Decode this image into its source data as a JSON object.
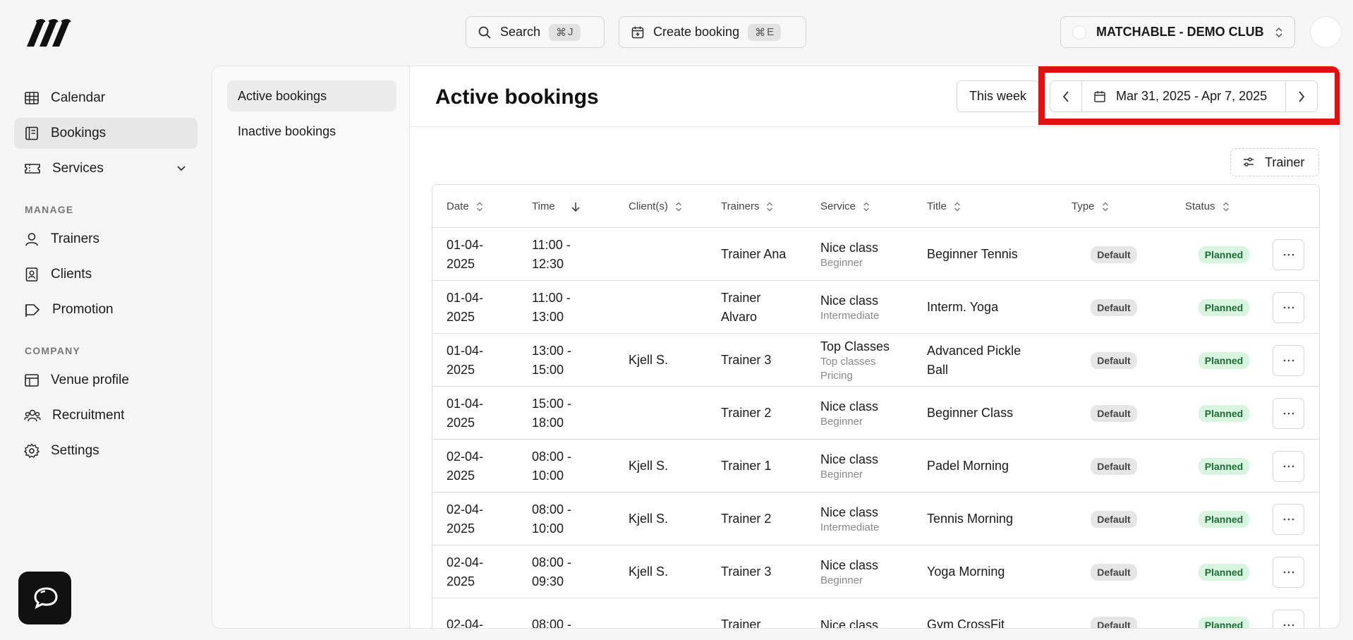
{
  "topbar": {
    "search_label": "Search",
    "search_shortcut_key": "J",
    "create_label": "Create booking",
    "create_shortcut_key": "E",
    "club_name": "MATCHABLE - DEMO CLUB"
  },
  "sidebar": {
    "items": [
      {
        "label": "Calendar",
        "icon": "calendar-grid-icon"
      },
      {
        "label": "Bookings",
        "icon": "bookings-icon"
      },
      {
        "label": "Services",
        "icon": "ticket-icon"
      }
    ],
    "manage_label": "MANAGE",
    "manage_items": [
      {
        "label": "Trainers",
        "icon": "user-icon"
      },
      {
        "label": "Clients",
        "icon": "contact-icon"
      },
      {
        "label": "Promotion",
        "icon": "tag-icon"
      }
    ],
    "company_label": "COMPANY",
    "company_items": [
      {
        "label": "Venue profile",
        "icon": "layout-icon"
      },
      {
        "label": "Recruitment",
        "icon": "users-icon"
      },
      {
        "label": "Settings",
        "icon": "gear-icon"
      }
    ]
  },
  "subnav": {
    "active": "Active bookings",
    "inactive": "Inactive bookings"
  },
  "main": {
    "title": "Active bookings",
    "this_week": "This week",
    "date_range": "Mar 31, 2025 - Apr 7, 2025",
    "filter_label": "Trainer"
  },
  "table": {
    "headers": [
      "Date",
      "Time",
      "Client(s)",
      "Trainers",
      "Service",
      "Title",
      "Type",
      "Status"
    ],
    "rows": [
      {
        "date1": "01-04-",
        "date2": "2025",
        "time1": "11:00 -",
        "time2": "12:30",
        "client": "",
        "trainer1": "Trainer Ana",
        "trainer2": "",
        "service": "Nice class",
        "service_sub": "Beginner",
        "service_sub2": "",
        "title1": "Beginner Tennis",
        "title2": "",
        "type": "Default",
        "status": "Planned"
      },
      {
        "date1": "01-04-",
        "date2": "2025",
        "time1": "11:00 -",
        "time2": "13:00",
        "client": "",
        "trainer1": "Trainer",
        "trainer2": "Alvaro",
        "service": "Nice class",
        "service_sub": "Intermediate",
        "service_sub2": "",
        "title1": "Interm. Yoga",
        "title2": "",
        "type": "Default",
        "status": "Planned"
      },
      {
        "date1": "01-04-",
        "date2": "2025",
        "time1": "13:00 -",
        "time2": "15:00",
        "client": "Kjell S.",
        "trainer1": "Trainer 3",
        "trainer2": "",
        "service": "Top Classes",
        "service_sub": "Top classes",
        "service_sub2": "Pricing",
        "title1": "Advanced Pickle",
        "title2": "Ball",
        "type": "Default",
        "status": "Planned"
      },
      {
        "date1": "01-04-",
        "date2": "2025",
        "time1": "15:00 -",
        "time2": "18:00",
        "client": "",
        "trainer1": "Trainer 2",
        "trainer2": "",
        "service": "Nice class",
        "service_sub": "Beginner",
        "service_sub2": "",
        "title1": "Beginner Class",
        "title2": "",
        "type": "Default",
        "status": "Planned"
      },
      {
        "date1": "02-04-",
        "date2": "2025",
        "time1": "08:00 -",
        "time2": "10:00",
        "client": "Kjell S.",
        "trainer1": "Trainer 1",
        "trainer2": "",
        "service": "Nice class",
        "service_sub": "Beginner",
        "service_sub2": "",
        "title1": "Padel Morning",
        "title2": "",
        "type": "Default",
        "status": "Planned"
      },
      {
        "date1": "02-04-",
        "date2": "2025",
        "time1": "08:00 -",
        "time2": "10:00",
        "client": "Kjell S.",
        "trainer1": "Trainer 2",
        "trainer2": "",
        "service": "Nice class",
        "service_sub": "Intermediate",
        "service_sub2": "",
        "title1": "Tennis Morning",
        "title2": "",
        "type": "Default",
        "status": "Planned"
      },
      {
        "date1": "02-04-",
        "date2": "2025",
        "time1": "08:00 -",
        "time2": "09:30",
        "client": "Kjell S.",
        "trainer1": "Trainer 3",
        "trainer2": "",
        "service": "Nice class",
        "service_sub": "Beginner",
        "service_sub2": "",
        "title1": "Yoga Morning",
        "title2": "",
        "type": "Default",
        "status": "Planned"
      },
      {
        "date1": "02-04-",
        "date2": "",
        "time1": "08:00 -",
        "time2": "",
        "client": "",
        "trainer1": "Trainer",
        "trainer2": "",
        "service": "Nice class",
        "service_sub": "",
        "service_sub2": "",
        "title1": "Gym CrossFit",
        "title2": "",
        "type": "Default",
        "status": "Planned"
      }
    ]
  },
  "colors": {
    "highlight": "#e01010",
    "planned_bg": "#d7f5df",
    "planned_text": "#1f6b37"
  }
}
